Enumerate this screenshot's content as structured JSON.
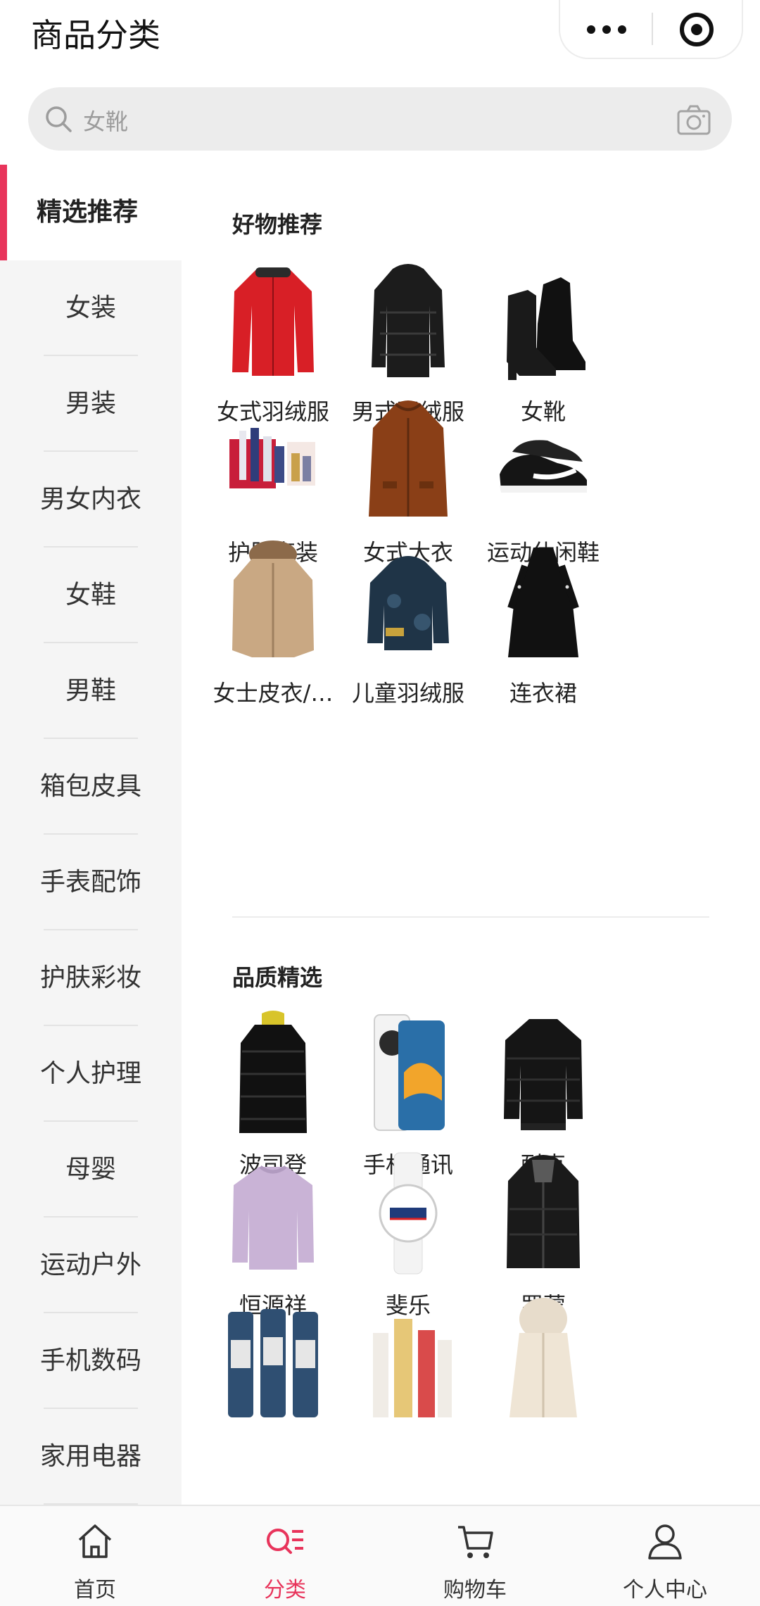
{
  "header": {
    "title": "商品分类"
  },
  "search": {
    "placeholder": "女靴"
  },
  "sidebar": {
    "active": "精选推荐",
    "items": [
      "精选推荐",
      "女装",
      "男装",
      "男女内衣",
      "女鞋",
      "男鞋",
      "箱包皮具",
      "手表配饰",
      "护肤彩妆",
      "个人护理",
      "母婴",
      "运动户外",
      "手机数码",
      "家用电器"
    ]
  },
  "sections": [
    {
      "title": "好物推荐",
      "products": [
        {
          "name": "女式羽绒服",
          "icon": "red-down-jacket"
        },
        {
          "name": "男式羽绒服",
          "icon": "black-down-jacket"
        },
        {
          "name": "女靴",
          "icon": "black-ankle-boots"
        },
        {
          "name": "护肤套装",
          "icon": "skincare-gift-set"
        },
        {
          "name": "女式大衣",
          "icon": "brown-hooded-coat"
        },
        {
          "name": "运动休闲鞋",
          "icon": "black-sneakers"
        },
        {
          "name": "女士皮衣/…",
          "icon": "beige-fur-hood-parka"
        },
        {
          "name": "儿童羽绒服",
          "icon": "kids-down-jacket"
        },
        {
          "name": "连衣裙",
          "icon": "black-dress"
        }
      ]
    },
    {
      "title": "品质精选",
      "products": [
        {
          "name": "波司登",
          "icon": "black-long-puffer"
        },
        {
          "name": "手机通讯",
          "icon": "smartphone"
        },
        {
          "name": "耐克",
          "icon": "black-bomber-jacket"
        },
        {
          "name": "恒源祥",
          "icon": "lilac-sweater"
        },
        {
          "name": "斐乐",
          "icon": "white-watch"
        },
        {
          "name": "罗蒙",
          "icon": "black-puffer-hooded"
        },
        {
          "name": "",
          "icon": "bottles"
        },
        {
          "name": "",
          "icon": "perfume-set"
        },
        {
          "name": "",
          "icon": "cream-vest"
        }
      ]
    }
  ],
  "tabbar": {
    "active": "分类",
    "items": [
      {
        "label": "首页",
        "icon": "home-icon"
      },
      {
        "label": "分类",
        "icon": "category-icon"
      },
      {
        "label": "购物车",
        "icon": "cart-icon"
      },
      {
        "label": "个人中心",
        "icon": "user-icon"
      }
    ]
  },
  "colors": {
    "accent": "#e8345b",
    "sidebar_bg": "#f5f5f5"
  }
}
